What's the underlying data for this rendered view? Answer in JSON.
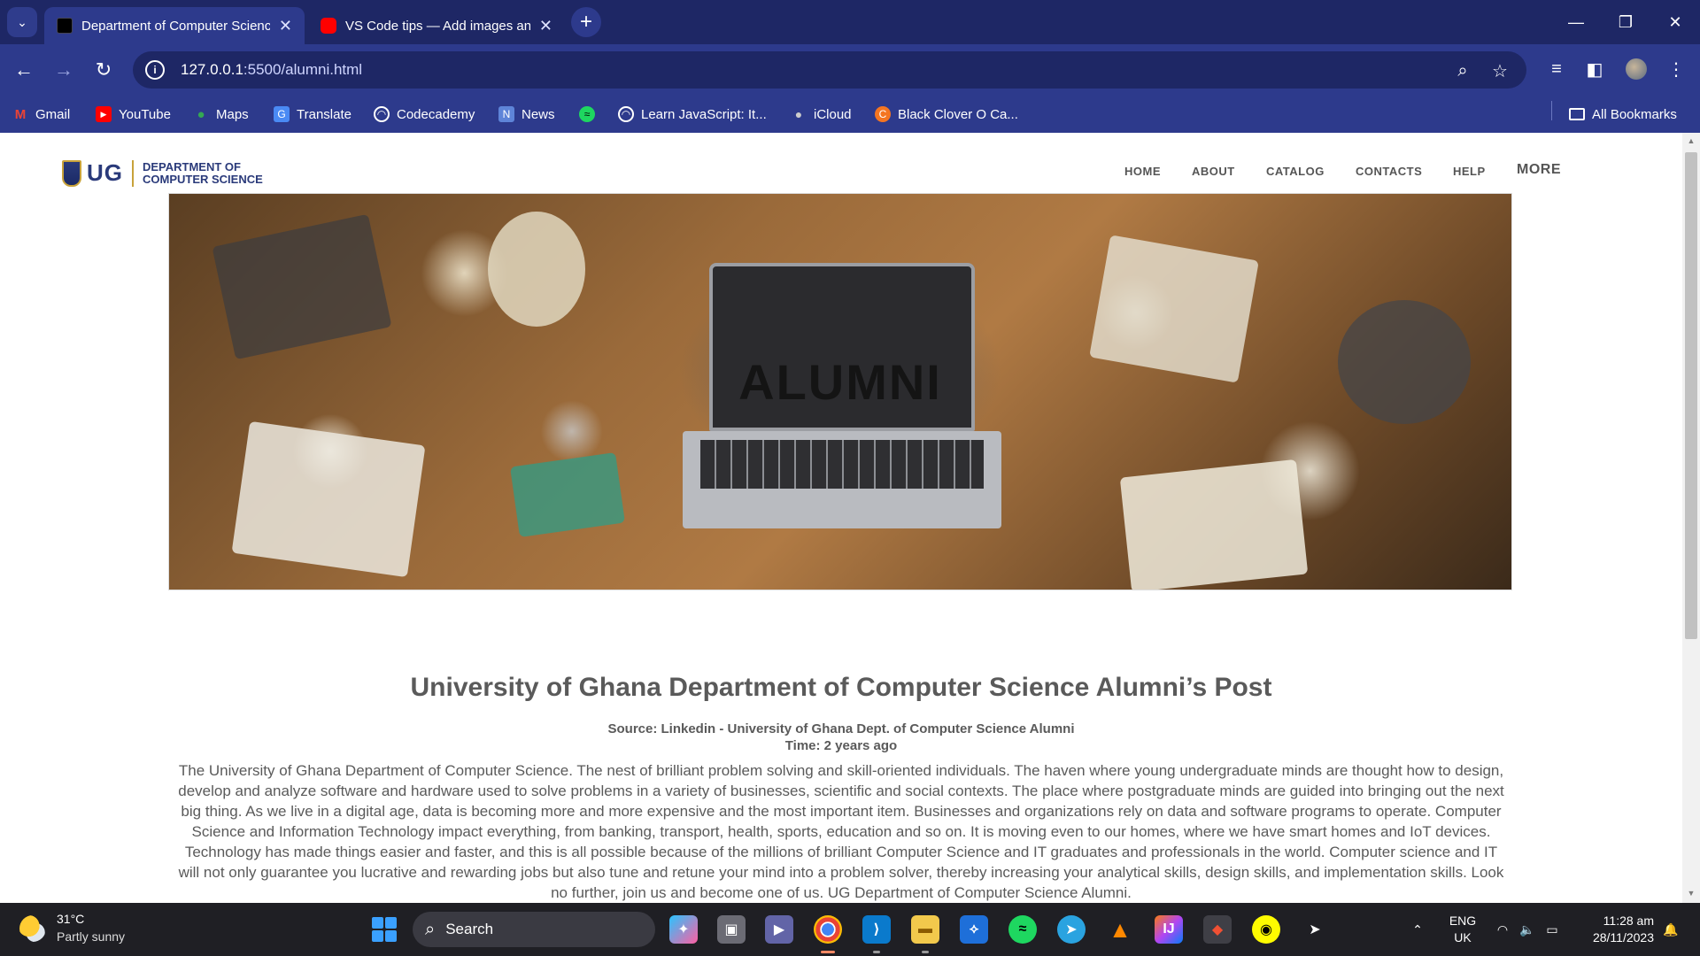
{
  "browser": {
    "tabs": [
      {
        "title": "Department of Computer Science",
        "active": true
      },
      {
        "title": "VS Code tips — Add images and...",
        "active": false
      }
    ],
    "url_host": "127.0.0.1",
    "url_path": ":5500/alumni.html",
    "bookmarks": [
      {
        "label": "Gmail",
        "icon": "gmail-icon"
      },
      {
        "label": "YouTube",
        "icon": "youtube-icon"
      },
      {
        "label": "Maps",
        "icon": "maps-icon"
      },
      {
        "label": "Translate",
        "icon": "translate-icon"
      },
      {
        "label": "Codecademy",
        "icon": "globe-icon"
      },
      {
        "label": "News",
        "icon": "news-icon"
      },
      {
        "label": "",
        "icon": "spotify-icon"
      },
      {
        "label": "Learn JavaScript: It...",
        "icon": "globe-icon"
      },
      {
        "label": "iCloud",
        "icon": "apple-icon"
      },
      {
        "label": "Black Clover O Ca...",
        "icon": "crunchyroll-icon"
      }
    ],
    "all_bookmarks": "All Bookmarks"
  },
  "site": {
    "logo_short": "UG",
    "logo_line1": "DEPARTMENT OF",
    "logo_line2": "COMPUTER SCIENCE",
    "nav": [
      "HOME",
      "ABOUT",
      "CATALOG",
      "CONTACTS",
      "HELP",
      "MORE"
    ],
    "hero_title": "ALUMNI",
    "post_title": "University of Ghana Department of Computer Science Alumni’s Post",
    "source": "Source: Linkedin - University of Ghana Dept. of Computer Science Alumni",
    "time": "Time: 2 years ago",
    "body": "The University of Ghana Department of Computer Science. The nest of brilliant problem solving and skill-oriented individuals. The haven where young undergraduate minds are thought how to design, develop and analyze software and hardware used to solve problems in a variety of businesses, scientific and social contexts. The place where postgraduate minds are guided into bringing out the next big thing. As we live in a digital age, data is becoming more and more expensive and the most important item. Businesses and organizations rely on data and software programs to operate. Computer Science and Information Technology impact everything, from banking, transport, health, sports, education and so on. It is moving even to our homes, where we have smart homes and IoT devices. Technology has made things easier and faster, and this is all possible because of the millions of brilliant Computer Science and IT graduates and professionals in the world. Computer science and IT will not only guarantee you lucrative and rewarding jobs but also tune and retune your mind into a problem solver, thereby increasing your analytical skills, design skills, and implementation skills. Look no further, join us and become one of us. UG Department of Computer Science Alumni."
  },
  "taskbar": {
    "temp": "31°C",
    "weather": "Partly sunny",
    "search": "Search",
    "lang1": "ENG",
    "lang2": "UK",
    "time": "11:28 am",
    "date": "28/11/2023"
  },
  "colors": {
    "chrome_dark": "#1e2765",
    "chrome": "#2d3a8c",
    "brand": "#2a3a7a",
    "text": "#5a5a5a"
  }
}
